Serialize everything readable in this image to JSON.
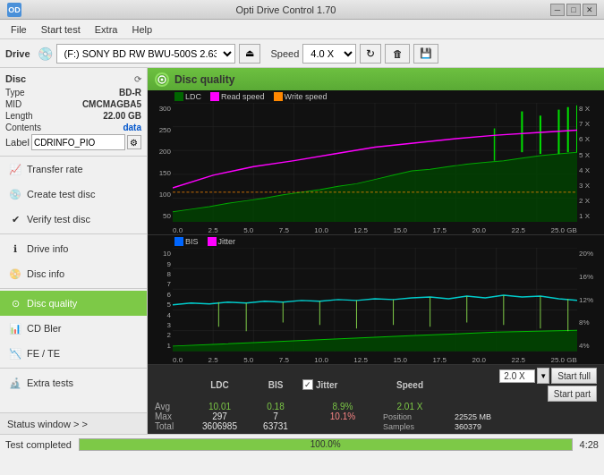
{
  "titlebar": {
    "title": "Opti Drive Control 1.70",
    "icon": "OD",
    "minimize": "─",
    "maximize": "□",
    "close": "✕"
  },
  "menubar": {
    "items": [
      "File",
      "Start test",
      "Extra",
      "Help"
    ]
  },
  "drivebar": {
    "drive_label": "Drive",
    "drive_icon": "💿",
    "drive_value": "(F:)  SONY BD RW BWU-500S 2.63",
    "speed_label": "Speed",
    "speed_value": "4.0 X",
    "refresh_icon": "↻",
    "erase_icon": "🗑",
    "save_icon": "💾"
  },
  "disc_panel": {
    "title": "Disc",
    "refresh_icon": "⟳",
    "type_label": "Type",
    "type_value": "BD-R",
    "mid_label": "MID",
    "mid_value": "CMCMAGBA5",
    "length_label": "Length",
    "length_value": "22.00 GB",
    "contents_label": "Contents",
    "contents_value": "data",
    "label_label": "Label",
    "label_value": "CDRINFO_PIO",
    "label_icon": "⚙"
  },
  "nav": {
    "items": [
      {
        "id": "transfer-rate",
        "label": "Transfer rate",
        "icon": "📈"
      },
      {
        "id": "create-test-disc",
        "label": "Create test disc",
        "icon": "💿"
      },
      {
        "id": "verify-test-disc",
        "label": "Verify test disc",
        "icon": "✔"
      },
      {
        "id": "drive-info",
        "label": "Drive info",
        "icon": "ℹ"
      },
      {
        "id": "disc-info",
        "label": "Disc info",
        "icon": "📀"
      },
      {
        "id": "disc-quality",
        "label": "Disc quality",
        "icon": "⊙",
        "active": true
      },
      {
        "id": "cd-bler",
        "label": "CD Bler",
        "icon": "📊"
      },
      {
        "id": "fe-te",
        "label": "FE / TE",
        "icon": "📉"
      },
      {
        "id": "extra-tests",
        "label": "Extra tests",
        "icon": "🔬"
      }
    ],
    "status_window": "Status window > >"
  },
  "disc_quality": {
    "title": "Disc quality",
    "legend": {
      "ldc_color": "#006600",
      "ldc_label": "LDC",
      "read_color": "#ff00ff",
      "read_label": "Read speed",
      "write_color": "#ff8800",
      "write_label": "Write speed"
    },
    "top_chart": {
      "y_labels_left": [
        "300",
        "250",
        "200",
        "150",
        "100",
        "50"
      ],
      "y_labels_right": [
        "8 X",
        "7 X",
        "6 X",
        "5 X",
        "4 X",
        "3 X",
        "2 X",
        "1 X"
      ],
      "x_labels": [
        "0.0",
        "2.5",
        "5.0",
        "7.5",
        "10.0",
        "12.5",
        "15.0",
        "17.5",
        "20.0",
        "22.5",
        "25.0 GB"
      ]
    },
    "bottom_chart": {
      "legend_bis_color": "#0066ff",
      "legend_bis_label": "BIS",
      "legend_jitter_color": "#ff00ff",
      "legend_jitter_label": "Jitter",
      "y_labels_left": [
        "10",
        "9",
        "8",
        "7",
        "6",
        "5",
        "4",
        "3",
        "2",
        "1"
      ],
      "y_labels_right": [
        "20%",
        "16%",
        "12%",
        "8%",
        "4%"
      ],
      "x_labels": [
        "0.0",
        "2.5",
        "5.0",
        "7.5",
        "10.0",
        "12.5",
        "15.0",
        "17.5",
        "20.0",
        "22.5",
        "25.0 GB"
      ]
    }
  },
  "stats": {
    "col_headers": [
      "",
      "LDC",
      "BIS",
      "Jitter",
      "Speed",
      ""
    ],
    "avg_label": "Avg",
    "avg_ldc": "10.01",
    "avg_bis": "0.18",
    "avg_jitter": "8.9%",
    "avg_speed": "2.01 X",
    "max_label": "Max",
    "max_ldc": "297",
    "max_bis": "7",
    "max_jitter": "10.1%",
    "position_label": "Position",
    "position_value": "22525 MB",
    "total_label": "Total",
    "total_ldc": "3606985",
    "total_bis": "63731",
    "samples_label": "Samples",
    "samples_value": "360379",
    "jitter_checked": true,
    "jitter_checkbox_label": "✓"
  },
  "controls": {
    "speed_value": "2.0 X",
    "start_full_label": "Start full",
    "start_part_label": "Start part"
  },
  "statusbar": {
    "status_text": "Test completed",
    "progress_value": 100,
    "progress_label": "100.0%",
    "time": "4:28"
  }
}
